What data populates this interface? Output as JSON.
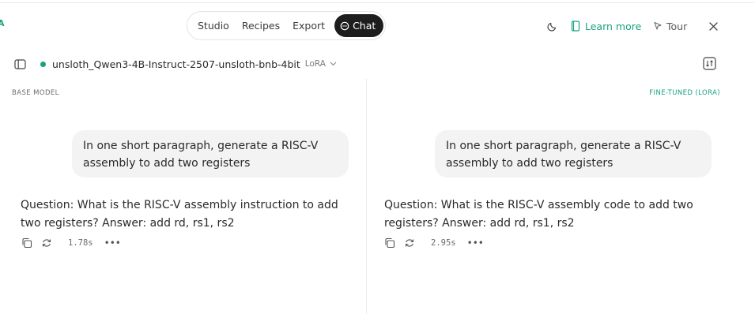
{
  "brand_fragment": "A",
  "nav": {
    "tabs": [
      {
        "label": "Studio"
      },
      {
        "label": "Recipes"
      },
      {
        "label": "Export"
      },
      {
        "label": "Chat"
      }
    ],
    "active_tab": "Chat"
  },
  "header_actions": {
    "theme_icon": "moon-icon",
    "learn_more_label": "Learn more",
    "tour_label": "Tour",
    "close_icon": "close-icon"
  },
  "model_bar": {
    "model_name": "unsloth_Qwen3-4B-Instruct-2507-unsloth-bnb-4bit",
    "adapter_tag": "LoRA",
    "status_color": "#16a37f"
  },
  "panels": {
    "base": {
      "label": "BASE MODEL",
      "prompt": "In one short paragraph, generate a RISC-V assembly to add two registers",
      "answer_line1": "Question: What is the RISC-V assembly instruction to add",
      "answer_line2": "two registers? Answer: add rd, rs1, rs2",
      "time": "1.78s"
    },
    "tuned": {
      "label": "FINE-TUNED (LORA)",
      "prompt": "In one short paragraph, generate a RISC-V assembly to add two registers",
      "answer_line1": "Question: What is the RISC-V assembly code to add two",
      "answer_line2": "registers? Answer: add rd, rs1, rs2",
      "time": "2.95s"
    }
  },
  "colors": {
    "accent": "#16a37f",
    "active_tab_bg": "#1d1d1d",
    "bubble_bg": "#f3f3f3"
  }
}
